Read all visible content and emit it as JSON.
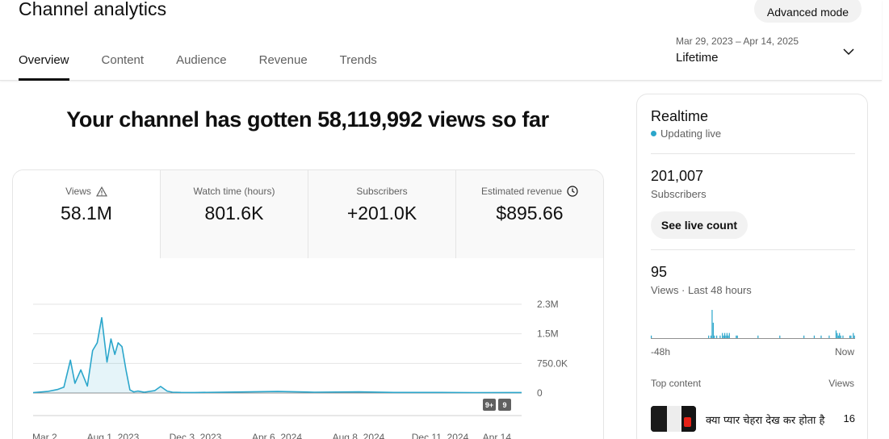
{
  "header": {
    "title": "Channel analytics",
    "advanced_mode_label": "Advanced mode",
    "tabs": [
      {
        "label": "Overview"
      },
      {
        "label": "Content"
      },
      {
        "label": "Audience"
      },
      {
        "label": "Revenue"
      },
      {
        "label": "Trends"
      }
    ],
    "date_range": "Mar 29, 2023 – Apr 14, 2025",
    "period": "Lifetime"
  },
  "headline": "Your channel has gotten 58,119,992 views so far",
  "metrics": [
    {
      "label": "Views",
      "value": "58.1M",
      "icon": "warning-icon"
    },
    {
      "label": "Watch time (hours)",
      "value": "801.6K"
    },
    {
      "label": "Subscribers",
      "value": "+201.0K"
    },
    {
      "label": "Estimated revenue",
      "value": "$895.66",
      "icon": "clock-icon"
    }
  ],
  "chart_data": {
    "type": "area",
    "series_color": "#2ba6cb",
    "x_tick_labels": [
      "Mar 2...",
      "Aug 1, 2023",
      "Dec 3, 2023",
      "Apr 6, 2024",
      "Aug 8, 2024",
      "Dec 11, 2024",
      "Apr 14..."
    ],
    "y_tick_labels": [
      "2.3M",
      "1.5M",
      "750.0K",
      "0"
    ],
    "ylim": [
      0,
      2300000
    ],
    "grid": true,
    "markers": [
      "9+",
      "9"
    ],
    "x": [
      "2023-03-29",
      "2023-04-20",
      "2023-05-05",
      "2023-05-15",
      "2023-05-25",
      "2023-06-01",
      "2023-06-10",
      "2023-06-20",
      "2023-06-28",
      "2023-07-05",
      "2023-07-12",
      "2023-07-20",
      "2023-07-26",
      "2023-08-01",
      "2023-08-06",
      "2023-08-12",
      "2023-08-18",
      "2023-08-24",
      "2023-08-30",
      "2023-09-05",
      "2023-09-15",
      "2023-10-01",
      "2023-10-10",
      "2023-10-20",
      "2023-10-28",
      "2023-11-10",
      "2023-12-01",
      "2024-02-01",
      "2024-04-06",
      "2024-06-01",
      "2024-08-08",
      "2024-10-01",
      "2024-12-11",
      "2025-02-01",
      "2025-04-14"
    ],
    "values": [
      10000,
      40000,
      90000,
      150000,
      850000,
      250000,
      600000,
      180000,
      1100000,
      1300000,
      1950000,
      800000,
      1400000,
      1000000,
      1300000,
      1200000,
      600000,
      80000,
      30000,
      50000,
      20000,
      60000,
      170000,
      50000,
      20000,
      15000,
      12000,
      25000,
      40000,
      20000,
      30000,
      15000,
      15000,
      10000,
      12000
    ]
  },
  "realtime": {
    "title": "Realtime",
    "status": "Updating live",
    "subscribers_value": "201,007",
    "subscribers_label": "Subscribers",
    "see_live_count_label": "See live count",
    "views_value": "95",
    "views_label": "Views · Last 48 hours",
    "axis_left": "-48h",
    "axis_right": "Now",
    "bar_values": [
      1,
      0,
      0,
      0,
      0,
      0,
      0,
      0,
      0,
      0,
      0,
      0,
      0,
      0,
      0,
      0,
      0,
      0,
      0,
      0,
      0,
      0,
      0,
      0,
      0,
      0,
      0,
      0,
      0,
      0,
      0,
      0,
      0,
      0,
      0,
      0,
      0,
      0,
      0,
      0,
      0,
      0,
      0,
      0,
      0,
      0,
      0,
      0,
      0,
      0,
      1,
      0,
      1,
      11,
      6,
      1,
      0,
      1,
      0,
      0,
      1,
      0,
      2,
      1,
      2,
      1,
      2,
      1,
      2,
      0,
      0,
      0,
      0,
      0,
      1,
      1,
      0,
      0,
      0,
      0,
      0,
      0,
      0,
      0,
      0,
      0,
      0,
      0,
      0,
      0,
      0,
      0,
      0,
      1,
      0,
      0,
      0,
      0,
      0,
      0,
      0,
      0,
      0,
      0,
      0,
      0,
      0,
      0,
      0,
      0,
      0,
      0,
      1,
      0,
      0,
      0,
      0,
      0,
      0,
      0,
      0,
      0,
      0,
      0,
      0,
      0,
      0,
      0,
      0,
      0,
      0,
      0,
      0,
      1,
      0,
      0,
      0,
      0,
      0,
      0,
      0,
      0,
      1,
      0,
      0,
      0,
      0,
      0,
      1,
      0,
      0,
      0,
      0,
      0,
      0,
      1,
      0,
      0,
      0,
      0,
      0,
      3,
      2,
      1,
      2,
      1,
      0,
      1,
      0,
      0,
      0,
      0,
      0,
      1,
      1,
      0,
      2,
      1
    ],
    "top_content_label": "Top content",
    "views_col_label": "Views",
    "top_content": [
      {
        "title": "क्या प्यार चेहरा देख कर होता है",
        "views": "16"
      }
    ]
  }
}
